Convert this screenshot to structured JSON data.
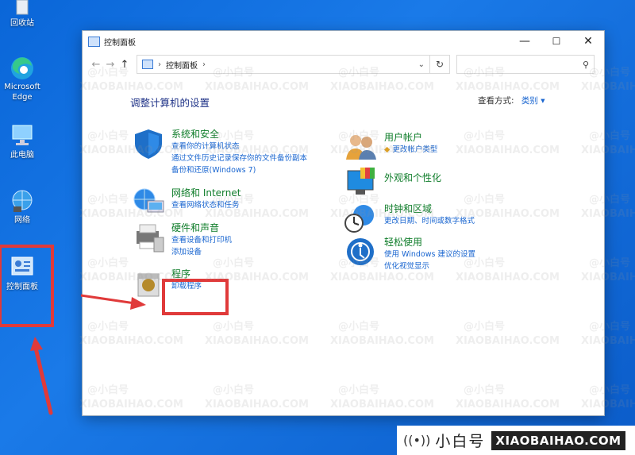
{
  "desktop": {
    "icons": [
      {
        "name": "recycle-bin",
        "label": "回收站"
      },
      {
        "name": "edge",
        "label": "Microsoft Edge"
      },
      {
        "name": "this-pc",
        "label": "此电脑"
      },
      {
        "name": "network",
        "label": "网络"
      },
      {
        "name": "control-panel",
        "label": "控制面板"
      }
    ]
  },
  "window": {
    "title": "控制面板",
    "controls": {
      "minimize": "—",
      "maximize": "☐",
      "close": "✕"
    }
  },
  "address": {
    "back": "←",
    "forward": "→",
    "up": "↑",
    "path": "控制面板",
    "separator": "›",
    "dropdown": "⌄",
    "refresh": "↻",
    "search_icon": "⚲"
  },
  "content": {
    "heading": "调整计算机的设置",
    "view_by_label": "查看方式:",
    "view_by_value": "类别 ▾",
    "left_categories": [
      {
        "title": "系统和安全",
        "links": [
          "查看你的计算机状态",
          "通过文件历史记录保存你的文件备份副本",
          "备份和还原(Windows 7)"
        ]
      },
      {
        "title": "网络和 Internet",
        "links": [
          "查看网络状态和任务"
        ]
      },
      {
        "title": "硬件和声音",
        "links": [
          "查看设备和打印机",
          "添加设备"
        ]
      },
      {
        "title": "程序",
        "links": [
          "卸载程序"
        ]
      }
    ],
    "right_categories": [
      {
        "title": "用户帐户",
        "links": [
          "更改帐户类型"
        ]
      },
      {
        "title": "外观和个性化",
        "links": []
      },
      {
        "title": "时钟和区域",
        "links": [
          "更改日期、时间或数字格式"
        ]
      },
      {
        "title": "轻松使用",
        "links": [
          "使用 Windows 建议的设置",
          "优化视觉显示"
        ]
      }
    ]
  },
  "watermark": {
    "cn": "@小白号",
    "en": "XIAOBAIHAO.COM"
  },
  "banner": {
    "cn": "小白号",
    "en": "XIAOBAIHAO.COM"
  },
  "colors": {
    "desktop": "#0b66d8",
    "link": "#1a66d0",
    "category_title": "#0f7d2a",
    "heading": "#1e3287",
    "highlight": "#e03a3a"
  }
}
